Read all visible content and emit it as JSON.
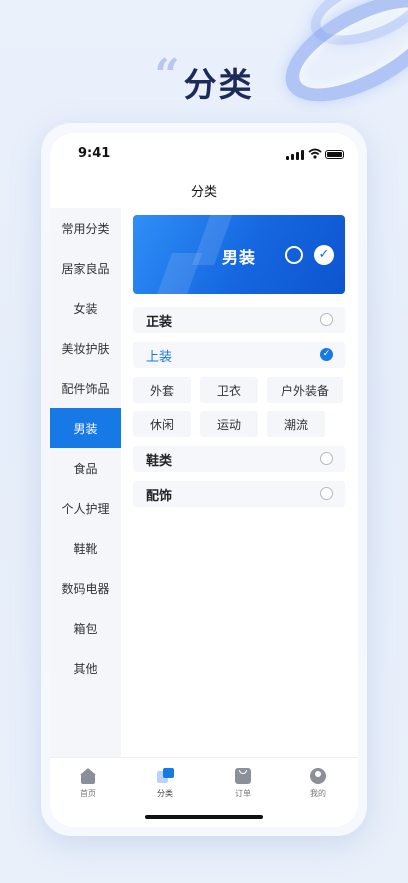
{
  "headline": {
    "quote": "“",
    "title": "分类"
  },
  "status_bar": {
    "time": "9:41"
  },
  "nav": {
    "title": "分类"
  },
  "sidebar": {
    "items": [
      {
        "label": "常用分类"
      },
      {
        "label": "居家良品"
      },
      {
        "label": "女装"
      },
      {
        "label": "美妆护肤"
      },
      {
        "label": "配件饰品"
      },
      {
        "label": "男装",
        "active": true
      },
      {
        "label": "食品"
      },
      {
        "label": "个人护理"
      },
      {
        "label": "鞋靴"
      },
      {
        "label": "数码电器"
      },
      {
        "label": "箱包"
      },
      {
        "label": "其他"
      }
    ]
  },
  "banner": {
    "label": "男装",
    "check": "✓"
  },
  "groups": {
    "formal": {
      "label": "正装",
      "selected": false
    },
    "tops": {
      "label": "上装",
      "selected": true,
      "check": "✓",
      "tags": [
        "外套",
        "卫衣",
        "户外装备",
        "休闲",
        "运动",
        "潮流"
      ]
    },
    "shoes": {
      "label": "鞋类",
      "selected": false
    },
    "accessories": {
      "label": "配饰",
      "selected": false
    }
  },
  "tabbar": {
    "home": "首页",
    "category": "分类",
    "orders": "订单",
    "mine": "我的"
  },
  "colors": {
    "accent": "#1779e6",
    "headline": "#1c2a5a"
  }
}
